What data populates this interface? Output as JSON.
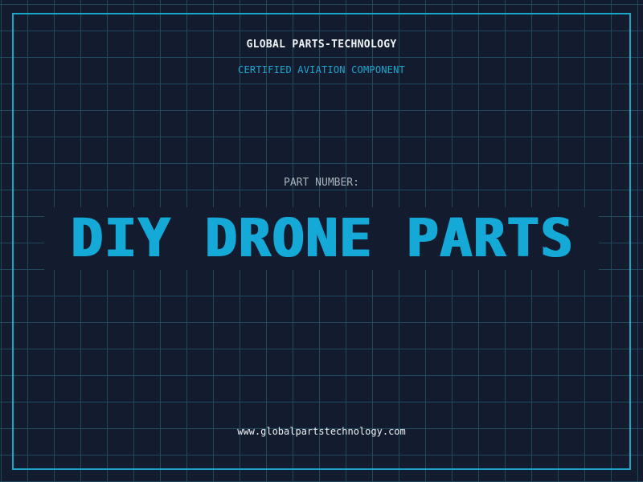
{
  "header": {
    "company": "GLOBAL PARTS-TECHNOLOGY",
    "subtitle": "CERTIFIED AVIATION COMPONENT"
  },
  "part": {
    "label": "PART NUMBER:",
    "value": "DIY DRONE PARTS"
  },
  "footer": {
    "website": "www.globalpartstechnology.com"
  },
  "colors": {
    "background": "#121c2e",
    "grid": "#1f4a5c",
    "frame": "#1aa6c9",
    "accent": "#14a9d6",
    "text": "#eef2f5",
    "muted": "#a9b2bd"
  }
}
